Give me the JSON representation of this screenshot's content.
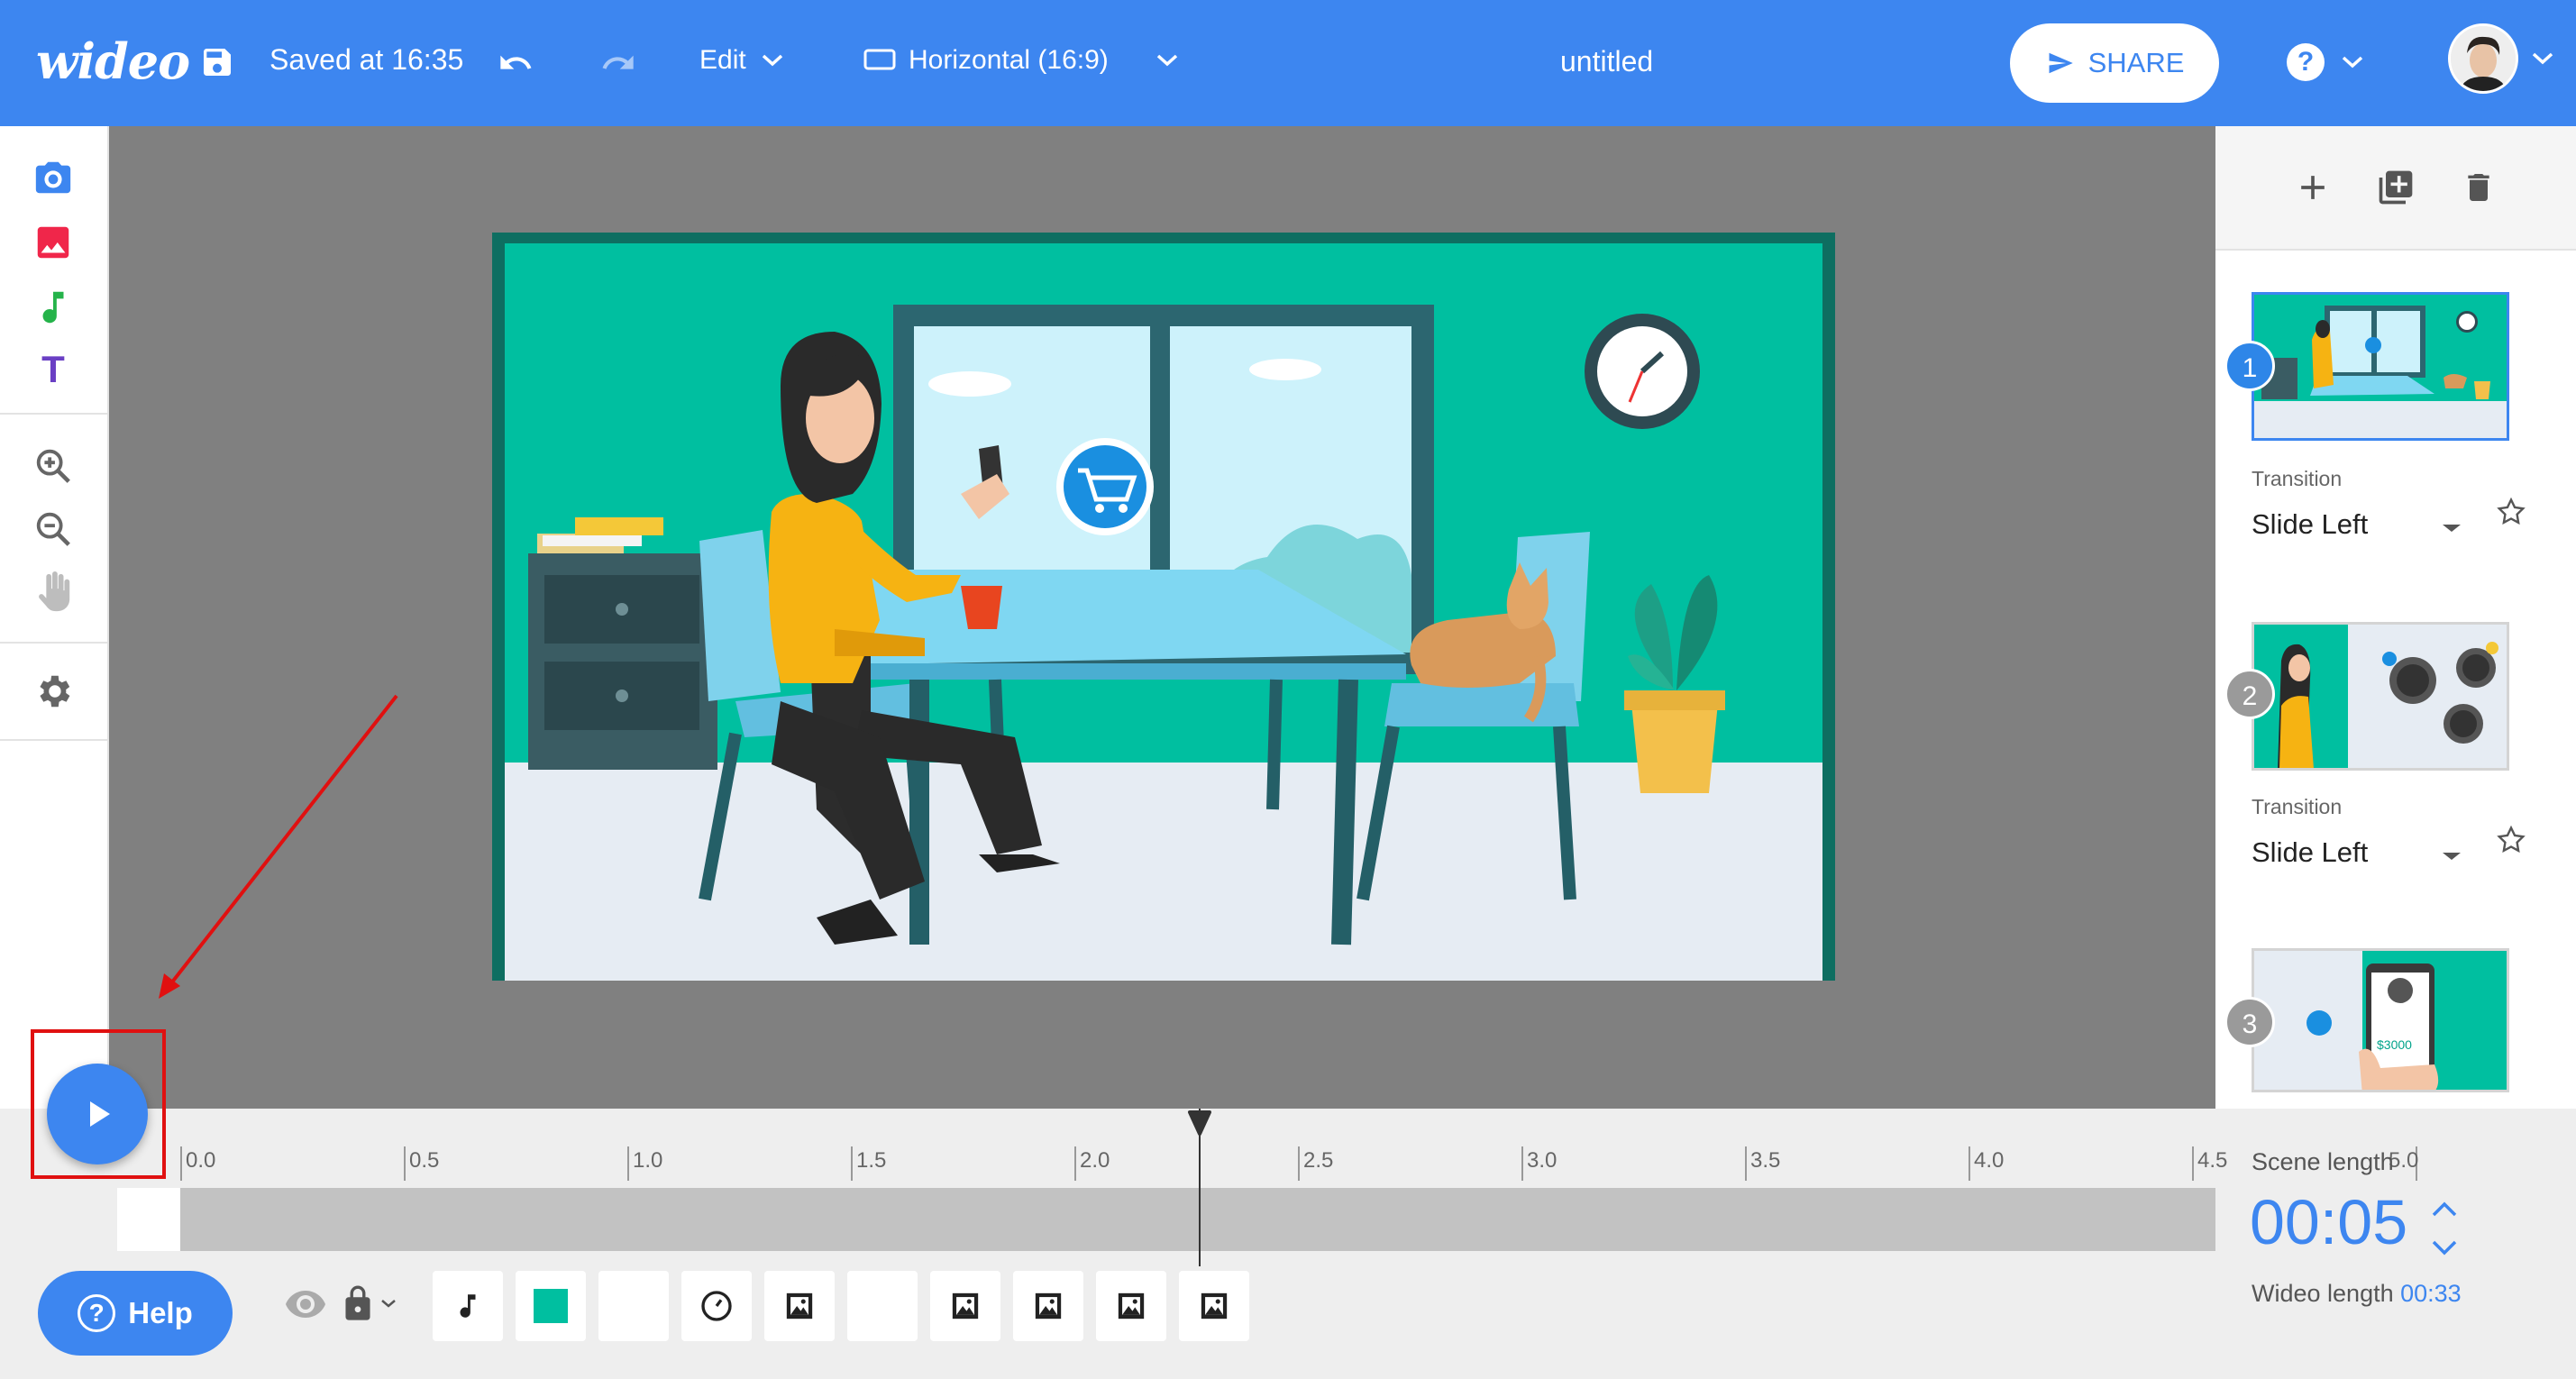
{
  "header": {
    "logo": "wideo",
    "saved_text": "Saved at 16:35",
    "edit_label": "Edit",
    "format_label": "Horizontal (16:9)",
    "doc_title": "untitled",
    "share_label": "SHARE",
    "help_symbol": "?"
  },
  "left_toolbar": {
    "items": [
      "camera-icon",
      "image-icon",
      "music-icon",
      "text-icon",
      "zoom-in-icon",
      "zoom-out-icon",
      "hand-icon",
      "settings-icon"
    ],
    "text_tool_glyph": "T"
  },
  "scenes": [
    {
      "number": "1",
      "transition_label": "Transition",
      "transition": "Slide Left",
      "selected": true
    },
    {
      "number": "2",
      "transition_label": "Transition",
      "transition": "Slide Left",
      "selected": false
    },
    {
      "number": "3",
      "selected": false,
      "price_label": "$3000"
    }
  ],
  "timeline": {
    "ticks": [
      "0.0",
      "0.5",
      "1.0",
      "1.5",
      "2.0",
      "2.5",
      "3.0",
      "3.5",
      "4.0",
      "4.5",
      "5.0"
    ],
    "playhead_value": 2.5,
    "layers": [
      "music-icon",
      "color-swatch",
      "blank",
      "clock-icon",
      "image-icon",
      "blank",
      "image-icon",
      "image-icon",
      "image-icon",
      "image-icon"
    ]
  },
  "help_button": {
    "label": "Help",
    "symbol": "?"
  },
  "scene_length": {
    "label": "Scene length",
    "value": "00:05"
  },
  "video_length": {
    "label": "Wideo length",
    "value": "00:33"
  },
  "colors": {
    "brand": "#3d86f0",
    "scene_bg": "#00b89b",
    "highlight": "#e01010"
  }
}
